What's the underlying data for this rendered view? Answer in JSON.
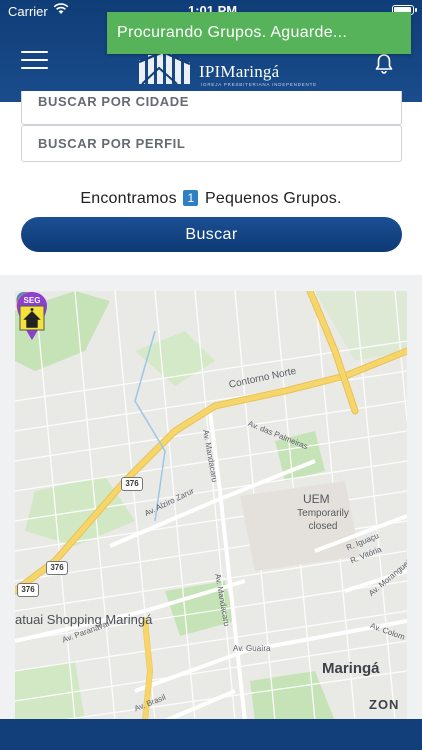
{
  "status": {
    "carrier": "Carrier",
    "time": "1:01 PM",
    "battery_level": 1.0
  },
  "toast": {
    "message": "Procurando Grupos. Aguarde..."
  },
  "header": {
    "logo_name": "IPIMaringá",
    "logo_tagline": "IGREJA PRESBITERIANA INDEPENDENTE",
    "menu_icon": "hamburger-menu-icon",
    "notification_icon": "bell-icon"
  },
  "filters": {
    "city_label": "BUSCAR POR CIDADE",
    "profile_label": "BUSCAR POR PERFIL"
  },
  "result": {
    "prefix": "Encontramos",
    "count": "1",
    "suffix": "Pequenos Grupos."
  },
  "search_button": {
    "label": "Buscar"
  },
  "map": {
    "labels": {
      "contorno_norte": "Contorno Norte",
      "av_palmeiras": "Av. das Palmeiras",
      "av_mandacaru_1": "Av. Mandacaru",
      "av_mandacaru_2": "Av. Mandacaru",
      "av_alziro_zarur": "Av. Alziro Zarur",
      "uem": "UEM",
      "uem_status": "Temporarily closed",
      "r_iguacu": "R. Iguaçu",
      "r_vitoria": "R. Vitória",
      "av_morangueira": "Av. Morangueira",
      "av_colom": "Av. Colom",
      "shopping": "atuai Shopping Maringá",
      "av_paranavai": "Av. Paranavaí",
      "av_guaira": "Av. Guaíra",
      "av_brasil": "Av. Brasil",
      "city": "Maringá",
      "zone": "ZON"
    },
    "highway_shields": [
      "376",
      "376",
      "376"
    ],
    "church_marker_text": "SEG",
    "colors": {
      "road_major": "#f6d66b",
      "park": "#c6e3b7",
      "marker_user": "#f08a24",
      "marker_church": "#8c3fd1"
    }
  }
}
